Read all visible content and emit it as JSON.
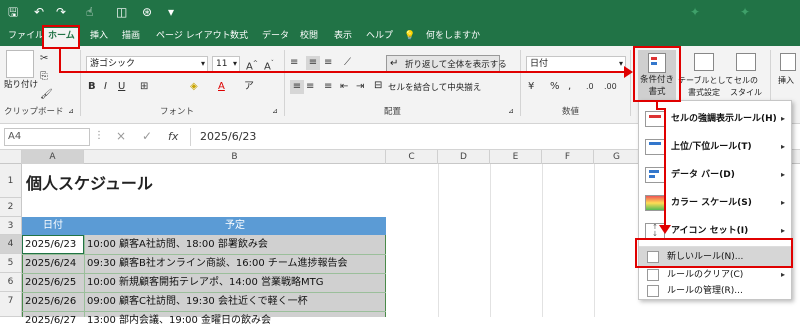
{
  "formula_bar": {
    "name_box": "A4",
    "content": "2025/6/23",
    "cancel_icon": "×",
    "confirm_icon": "✓",
    "fx_icon": "fx"
  },
  "tabs": [
    "ファイル",
    "ホーム",
    "挿入",
    "描画",
    "ページ レイアウト",
    "数式",
    "データ",
    "校閲",
    "表示",
    "ヘルプ"
  ],
  "tell_me": "何をしますか",
  "ribbon": {
    "paste": "貼り付け",
    "clipboard_group": "クリップボード",
    "font_name": "游ゴシック",
    "font_size": "11",
    "font_group": "フォント",
    "wrap_text": "折り返して全体を表示する",
    "merge_center": "セルを結合して中央揃え",
    "alignment_group": "配置",
    "number_format": "日付",
    "number_group": "数値",
    "cond_format": [
      "条件付き",
      "書式"
    ],
    "table_format": [
      "テーブルとして",
      "書式設定"
    ],
    "cell_style": [
      "セルの",
      "スタイル"
    ],
    "insert": "挿入"
  },
  "columns": [
    "A",
    "B",
    "C",
    "D",
    "E",
    "F",
    "G"
  ],
  "rows": [
    "1",
    "2",
    "3",
    "4",
    "5",
    "6",
    "7"
  ],
  "sheet": {
    "title": "個人スケジュール",
    "header_date": "日付",
    "header_plan": "予定",
    "data": [
      {
        "date": "2025/6/23",
        "plan": "10:00 顧客A社訪問、18:00 部署飲み会"
      },
      {
        "date": "2025/6/24",
        "plan": "09:30 顧客B社オンライン商談、16:00 チーム進捗報告会"
      },
      {
        "date": "2025/6/25",
        "plan": "10:00 新規顧客開拓テレアポ、14:00 営業戦略MTG"
      },
      {
        "date": "2025/6/26",
        "plan": "09:00 顧客C社訪問、19:30 会社近くで軽く一杯"
      },
      {
        "date": "2025/6/27",
        "plan": "13:00 部内会議、19:00 金曜日の飲み会"
      }
    ]
  },
  "menu": [
    {
      "label": "セルの強調表示ルール(H)",
      "arrow": "▸"
    },
    {
      "label": "上位/下位ルール(T)",
      "arrow": "▸"
    },
    {
      "label": "データ バー(D)",
      "arrow": "▸"
    },
    {
      "label": "カラー スケール(S)",
      "arrow": "▸"
    },
    {
      "label": "アイコン セット(I)",
      "arrow": "▸"
    },
    {
      "label": "新しいルール(N)..."
    },
    {
      "label": "ルールのクリア(C)",
      "arrow": "▸"
    },
    {
      "label": "ルールの管理(R)..."
    }
  ],
  "colors": {
    "excel_green": "#217346",
    "header_blue": "#5b9bd5",
    "highlight": "#e00000"
  }
}
